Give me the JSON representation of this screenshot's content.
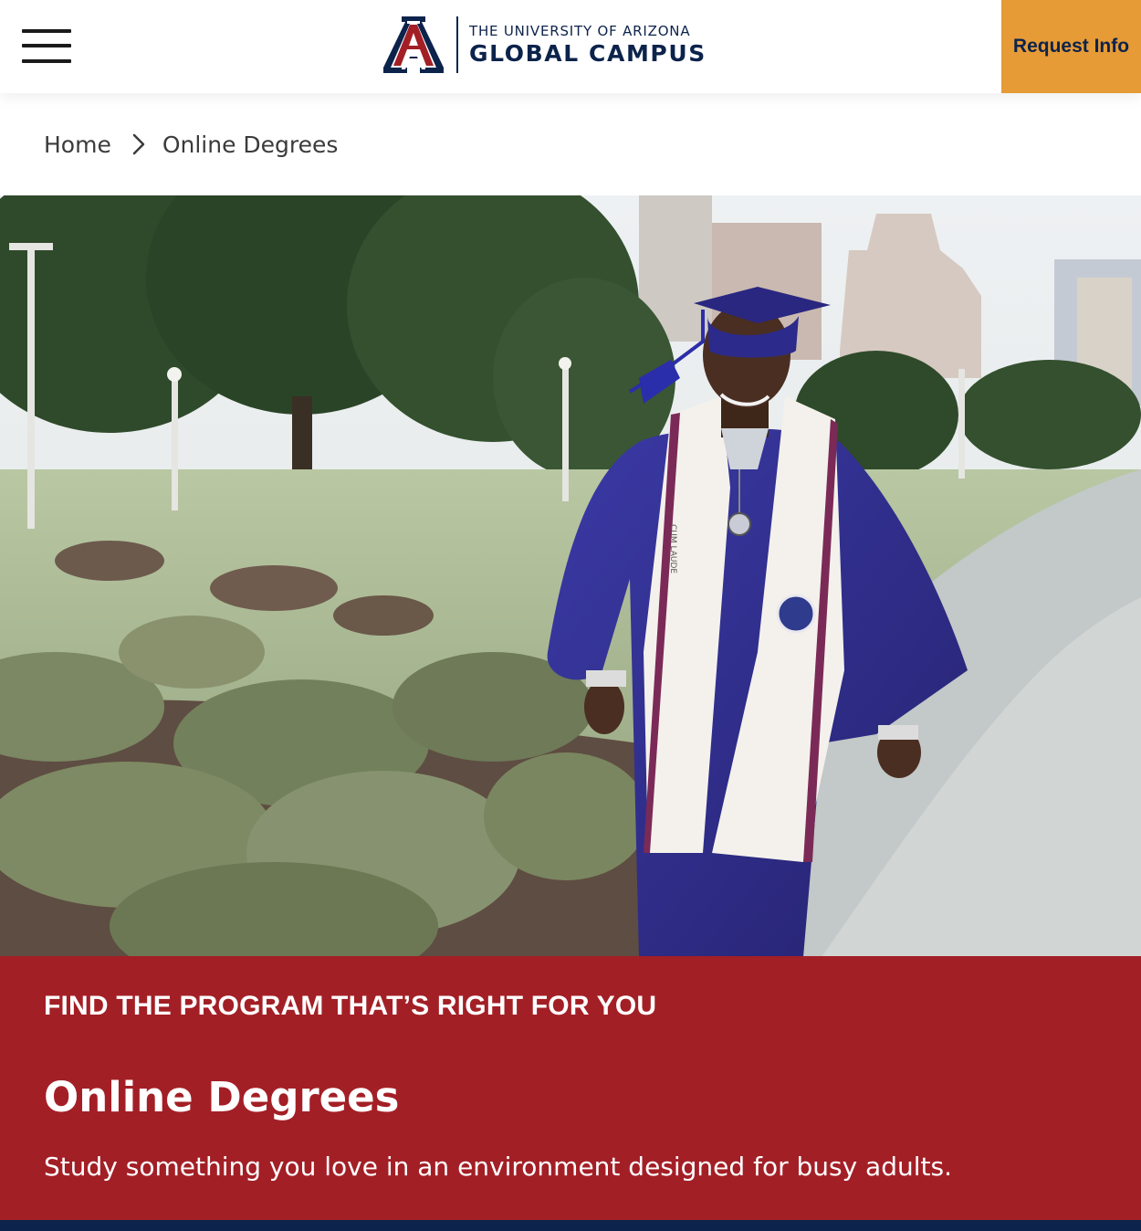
{
  "header": {
    "menu_icon": "hamburger-menu-icon",
    "logo": {
      "line1": "THE UNIVERSITY OF ARIZONA",
      "line2": "GLOBAL CAMPUS",
      "mark": "A"
    },
    "request_label": "Request Info"
  },
  "breadcrumb": {
    "home": "Home",
    "separator_icon": "chevron-right-icon",
    "current": "Online Degrees"
  },
  "hero": {
    "stole_text": "CUM LAUDE"
  },
  "banner": {
    "eyebrow": "FIND THE PROGRAM THAT’S RIGHT FOR YOU",
    "title": "Online Degrees",
    "subtitle": "Study something you love in an environment designed for busy adults."
  },
  "colors": {
    "navy": "#0c234b",
    "red": "#a31f26",
    "gold": "#e69b37"
  }
}
